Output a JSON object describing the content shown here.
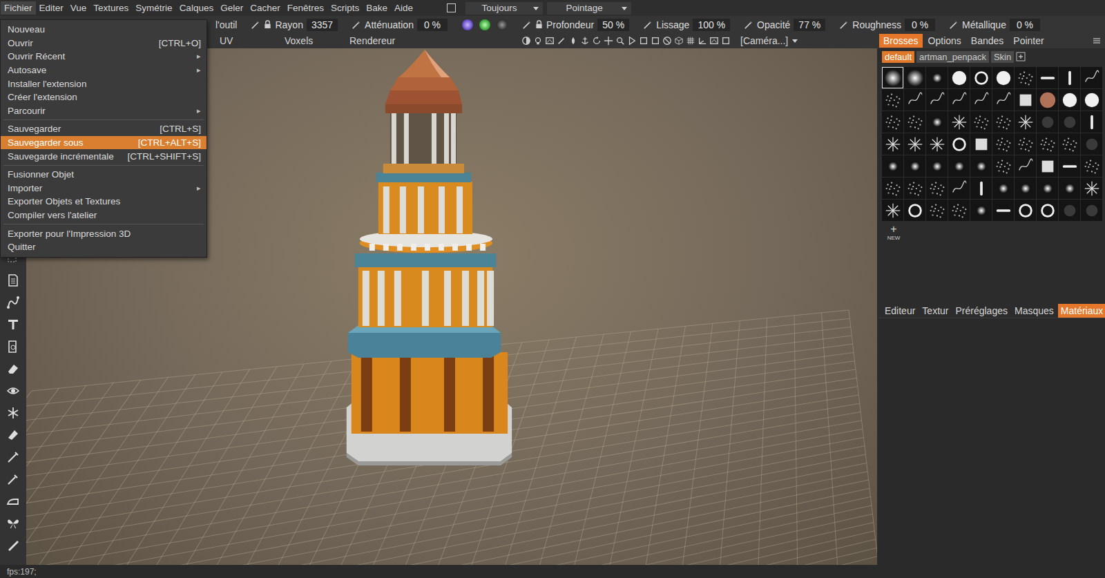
{
  "menu_bar": {
    "items": [
      {
        "label": "Fichier",
        "selected": true
      },
      {
        "label": "Editer",
        "selected": false
      },
      {
        "label": "Vue",
        "selected": false
      },
      {
        "label": "Textures",
        "selected": false
      },
      {
        "label": "Symétrie",
        "selected": false
      },
      {
        "label": "Calques",
        "selected": false
      },
      {
        "label": "Geler",
        "selected": false
      },
      {
        "label": "Cacher",
        "selected": false
      },
      {
        "label": "Fenêtres",
        "selected": false
      },
      {
        "label": "Scripts",
        "selected": false
      },
      {
        "label": "Bake",
        "selected": false
      },
      {
        "label": "Aide",
        "selected": false
      }
    ],
    "visibility_checkbox": {
      "checked": false
    },
    "dropdowns": [
      "Toujours",
      "Pointage"
    ]
  },
  "tool_options": {
    "title_fragment": "l'outil",
    "fields": [
      {
        "label": "Rayon",
        "value": "3357",
        "locked": true
      },
      {
        "label": "Atténuation",
        "value": "0 %",
        "locked": false
      },
      {
        "label": "Profondeur",
        "value": "50 %",
        "locked": true
      },
      {
        "label": "Lissage",
        "value": "100 %",
        "locked": false
      },
      {
        "label": "Opacité",
        "value": "77 %",
        "locked": false
      },
      {
        "label": "Roughness",
        "value": "0 %",
        "locked": false
      },
      {
        "label": "Métallique",
        "value": "0 %",
        "locked": false
      }
    ]
  },
  "rooms": [
    {
      "label": "UV",
      "selected": false
    },
    {
      "label": "Voxels",
      "selected": false
    },
    {
      "label": "Rendereur",
      "selected": false
    }
  ],
  "camera": {
    "label": "[Caméra...]"
  },
  "file_menu": {
    "submenu_arrow": "▸",
    "items": [
      {
        "kind": "item",
        "label": "Nouveau",
        "submenu": false,
        "selected": false
      },
      {
        "kind": "item",
        "label": "Ouvrir",
        "shortcut": "[CTRL+O]",
        "submenu": false,
        "selected": false
      },
      {
        "kind": "item",
        "label": "Ouvrir Récent",
        "submenu": true,
        "selected": false
      },
      {
        "kind": "item",
        "label": "Autosave",
        "submenu": true,
        "selected": false
      },
      {
        "kind": "item",
        "label": "Installer l'extension",
        "submenu": false,
        "selected": false
      },
      {
        "kind": "item",
        "label": "Créer l'extension",
        "submenu": false,
        "selected": false
      },
      {
        "kind": "item",
        "label": "Parcourir",
        "submenu": true,
        "selected": false
      },
      {
        "kind": "separator"
      },
      {
        "kind": "item",
        "label": "Sauvegarder",
        "shortcut": "[CTRL+S]",
        "submenu": false,
        "selected": false
      },
      {
        "kind": "item",
        "label": "Sauvegarder sous",
        "shortcut": "[CTRL+ALT+S]",
        "submenu": false,
        "selected": true
      },
      {
        "kind": "item",
        "label": "Sauvegarde incrémentale",
        "shortcut": "[CTRL+SHIFT+S]",
        "submenu": false,
        "selected": false
      },
      {
        "kind": "separator"
      },
      {
        "kind": "item",
        "label": "Fusionner Objet",
        "submenu": false,
        "selected": false
      },
      {
        "kind": "item",
        "label": "Importer",
        "submenu": true,
        "selected": false
      },
      {
        "kind": "item",
        "label": "Exporter Objets et Textures",
        "submenu": false,
        "selected": false
      },
      {
        "kind": "item",
        "label": "Compiler vers l'atelier",
        "submenu": false,
        "selected": false
      },
      {
        "kind": "separator"
      },
      {
        "kind": "item",
        "label": "Exporter pour l'Impression 3D",
        "submenu": false,
        "selected": false
      },
      {
        "kind": "item",
        "label": "Quitter",
        "submenu": false,
        "selected": false
      }
    ]
  },
  "right_panel": {
    "tabs": [
      {
        "label": "Brosses",
        "selected": true
      },
      {
        "label": "Options",
        "selected": false
      },
      {
        "label": "Bandes",
        "selected": false
      },
      {
        "label": "Pointer",
        "selected": false
      }
    ],
    "brush_sets": [
      {
        "label": "default",
        "selected": true
      },
      {
        "label": "artman_penpack",
        "selected": false
      },
      {
        "label": "Skin",
        "selected": false
      }
    ],
    "brushes": [
      {
        "kind": "soft",
        "selected": true
      },
      {
        "kind": "soft",
        "selected": false
      },
      {
        "kind": "spot",
        "selected": false
      },
      {
        "kind": "disc",
        "selected": false
      },
      {
        "kind": "ring",
        "selected": false
      },
      {
        "kind": "disc",
        "selected": false
      },
      {
        "kind": "noise",
        "selected": false
      },
      {
        "kind": "bar",
        "selected": false
      },
      {
        "kind": "vbar",
        "selected": false
      },
      {
        "kind": "stroke",
        "selected": false
      },
      {
        "kind": "noise",
        "selected": false
      },
      {
        "kind": "stroke",
        "selected": false
      },
      {
        "kind": "stroke",
        "selected": false
      },
      {
        "kind": "stroke",
        "selected": false
      },
      {
        "kind": "stroke",
        "selected": false
      },
      {
        "kind": "stroke",
        "selected": false
      },
      {
        "kind": "square",
        "selected": false
      },
      {
        "kind": "copper",
        "selected": false
      },
      {
        "kind": "disc",
        "selected": false
      },
      {
        "kind": "disc",
        "selected": false
      },
      {
        "kind": "noise",
        "selected": false
      },
      {
        "kind": "noise",
        "selected": false
      },
      {
        "kind": "spot",
        "selected": false
      },
      {
        "kind": "star",
        "selected": false
      },
      {
        "kind": "noise",
        "selected": false
      },
      {
        "kind": "noise",
        "selected": false
      },
      {
        "kind": "star",
        "selected": false
      },
      {
        "kind": "dark",
        "selected": false
      },
      {
        "kind": "dark",
        "selected": false
      },
      {
        "kind": "vbar",
        "selected": false
      },
      {
        "kind": "star",
        "selected": false
      },
      {
        "kind": "star",
        "selected": false
      },
      {
        "kind": "star",
        "selected": false
      },
      {
        "kind": "ring",
        "selected": false
      },
      {
        "kind": "square",
        "selected": false
      },
      {
        "kind": "noise",
        "selected": false
      },
      {
        "kind": "noise",
        "selected": false
      },
      {
        "kind": "noise",
        "selected": false
      },
      {
        "kind": "noise",
        "selected": false
      },
      {
        "kind": "dark",
        "selected": false
      },
      {
        "kind": "spot",
        "selected": false
      },
      {
        "kind": "spot",
        "selected": false
      },
      {
        "kind": "spot",
        "selected": false
      },
      {
        "kind": "spot",
        "selected": false
      },
      {
        "kind": "spot",
        "selected": false
      },
      {
        "kind": "noise",
        "selected": false
      },
      {
        "kind": "stroke",
        "selected": false
      },
      {
        "kind": "square",
        "selected": false
      },
      {
        "kind": "bar",
        "selected": false
      },
      {
        "kind": "noise",
        "selected": false
      },
      {
        "kind": "noise",
        "selected": false
      },
      {
        "kind": "noise",
        "selected": false
      },
      {
        "kind": "noise",
        "selected": false
      },
      {
        "kind": "stroke",
        "selected": false
      },
      {
        "kind": "vbar",
        "selected": false
      },
      {
        "kind": "spot",
        "selected": false
      },
      {
        "kind": "spot",
        "selected": false
      },
      {
        "kind": "spot",
        "selected": false
      },
      {
        "kind": "spot",
        "selected": false
      },
      {
        "kind": "star",
        "selected": false
      },
      {
        "kind": "star",
        "selected": false
      },
      {
        "kind": "ring",
        "selected": false
      },
      {
        "kind": "noise",
        "selected": false
      },
      {
        "kind": "noise",
        "selected": false
      },
      {
        "kind": "spot",
        "selected": false
      },
      {
        "kind": "bar",
        "selected": false
      },
      {
        "kind": "ring",
        "selected": false
      },
      {
        "kind": "ring",
        "selected": false
      },
      {
        "kind": "dark",
        "selected": false
      },
      {
        "kind": "dark",
        "selected": false
      }
    ],
    "new_brush": {
      "icon": "+",
      "label": "NEW"
    },
    "lower_tabs": [
      {
        "label": "Editeur",
        "selected": false
      },
      {
        "label": "Textur",
        "selected": false
      },
      {
        "label": "Préréglages",
        "selected": false
      },
      {
        "label": "Masques",
        "selected": false
      },
      {
        "label": "Matériaux",
        "selected": true
      }
    ]
  },
  "status_bar": {
    "text": "fps:197;"
  }
}
